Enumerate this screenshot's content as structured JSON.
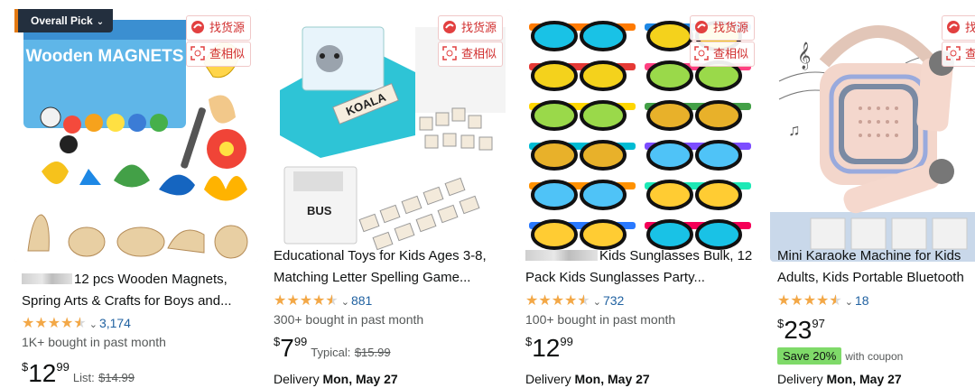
{
  "colors": {
    "star": "#f3a847",
    "link": "#2162a1",
    "badge_bg": "#232f3e",
    "coupon_bg": "#7fda69",
    "find_red": "#d12f2f"
  },
  "find_buttons": {
    "find_source": "找货源",
    "find_similar": "查相似"
  },
  "products": [
    {
      "badge": "Overall Pick",
      "title_text": "12 pcs Wooden Magnets, Spring Arts & Crafts for Boys and...",
      "rating_count": "3,174",
      "bought": "1K+ bought in past month",
      "price": {
        "symbol": "$",
        "whole": "12",
        "fraction": "99",
        "list_label": "List:",
        "list_price": "$14.99"
      },
      "box_art": "Wooden MAGNETS"
    },
    {
      "title": "Educational Toys for Kids Ages 3-8, Matching Letter Spelling Game...",
      "rating_count": "881",
      "bought": "300+ bought in past month",
      "price": {
        "symbol": "$",
        "whole": "7",
        "fraction": "99",
        "typical_label": "Typical:",
        "typical_price": "$15.99"
      },
      "delivery_label": "Delivery",
      "delivery_date": "Mon, May 27",
      "card_word": "KOALA",
      "card_word2": "BUS"
    },
    {
      "title_text": "Kids Sunglasses Bulk, 12 Pack Kids Sunglasses Party...",
      "rating_count": "732",
      "bought": "100+ bought in past month",
      "price": {
        "symbol": "$",
        "whole": "12",
        "fraction": "99"
      },
      "delivery_label": "Delivery",
      "delivery_date": "Mon, May 27"
    },
    {
      "title": "Mini Karaoke Machine for Kids Adults, Kids Portable Bluetooth",
      "rating_count": "18",
      "price": {
        "symbol": "$",
        "whole": "23",
        "fraction": "97"
      },
      "coupon": {
        "badge": "Save 20%",
        "text": "with coupon"
      },
      "delivery_label": "Delivery",
      "delivery_date": "Mon, May 27"
    }
  ]
}
